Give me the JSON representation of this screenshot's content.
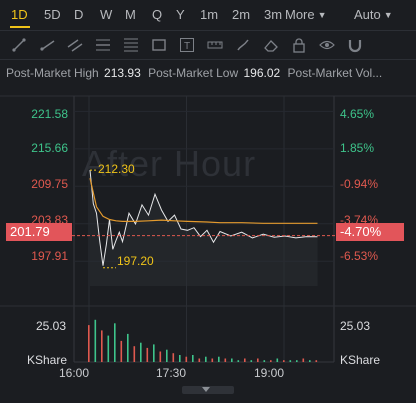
{
  "timeframes": {
    "items": [
      "1D",
      "5D",
      "D",
      "W",
      "M",
      "Q",
      "Y",
      "1m",
      "2m",
      "3m"
    ],
    "active": "1D",
    "more_label": "More",
    "auto_label": "Auto"
  },
  "toolbar_icons": [
    "trend-line-icon",
    "ray-tool-icon",
    "parallel-channel-icon",
    "horizontal-line-icon",
    "fibonacci-icon",
    "rectangle-icon",
    "text-tool-icon",
    "measure-icon",
    "brush-icon",
    "eraser-icon",
    "lock-icon",
    "visibility-icon",
    "magnet-icon"
  ],
  "info_bar": {
    "high_label": "Post-Market High",
    "high_value": "213.93",
    "low_label": "Post-Market Low",
    "low_value": "196.02",
    "vol_label": "Post-Market Vol..."
  },
  "watermark": "After Hour",
  "price_axis": [
    "221.58",
    "215.66",
    "209.75",
    "203.83",
    "197.91"
  ],
  "pct_axis": [
    "4.65%",
    "1.85%",
    "-0.94%",
    "-3.74%",
    "-6.53%"
  ],
  "current_price": "201.79",
  "current_pct": "-4.70%",
  "session_high": "212.30",
  "session_low": "197.20",
  "volume": {
    "top_label": "25.03",
    "unit_label": "KShare",
    "right_top_label": "25.03",
    "right_unit_label": "KShare"
  },
  "time_axis": [
    "16:00",
    "17:30",
    "19:00"
  ],
  "colors": {
    "up": "#3ec48b",
    "down": "#e0594f",
    "accent": "#f0c419",
    "avg_line": "#e39a2e",
    "price_line": "#e6e7e9"
  },
  "chart_data": {
    "type": "line",
    "title": "",
    "x_range": [
      "16:00",
      "20:00"
    ],
    "price_ylim": [
      194.0,
      224.0
    ],
    "reference_close": 211.7,
    "series": [
      {
        "x": [
          "16:00",
          "16:03",
          "16:06",
          "16:09",
          "16:12",
          "16:15",
          "16:18",
          "16:21",
          "16:24",
          "16:27",
          "16:30",
          "16:36",
          "16:42",
          "16:48",
          "16:54",
          "17:00",
          "17:06",
          "17:12",
          "17:18",
          "17:24",
          "17:30",
          "17:36",
          "17:42",
          "17:48",
          "17:54",
          "18:00",
          "18:10",
          "18:20",
          "18:30",
          "18:40",
          "18:50",
          "19:00",
          "19:10",
          "19:20",
          "19:30"
        ],
        "values": [
          212.3,
          207.0,
          205.5,
          201.0,
          197.2,
          200.5,
          204.5,
          199.8,
          201.2,
          202.5,
          201.0,
          205.5,
          203.8,
          206.8,
          205.2,
          208.5,
          206.0,
          204.2,
          205.2,
          203.0,
          202.8,
          203.2,
          201.8,
          202.8,
          200.9,
          202.6,
          201.9,
          202.5,
          201.6,
          202.2,
          201.7,
          201.9,
          201.6,
          201.8,
          201.79
        ]
      },
      {
        "x": [
          "16:00",
          "16:06",
          "16:12",
          "16:18",
          "16:24",
          "16:30",
          "16:42",
          "16:54",
          "17:06",
          "17:18",
          "17:30",
          "17:48",
          "18:00",
          "18:20",
          "18:40",
          "19:00",
          "19:20",
          "19:30"
        ],
        "values": [
          211.0,
          206.5,
          205.0,
          204.5,
          204.3,
          204.2,
          204.2,
          204.3,
          204.4,
          204.3,
          204.2,
          204.1,
          204.0,
          204.0,
          203.9,
          203.9,
          203.9,
          203.9
        ]
      }
    ],
    "volume": {
      "ylim": [
        0,
        25.03
      ],
      "x": [
        "16:00",
        "16:06",
        "16:12",
        "16:18",
        "16:24",
        "16:30",
        "16:36",
        "16:42",
        "16:48",
        "16:54",
        "17:00",
        "17:06",
        "17:12",
        "17:18",
        "17:24",
        "17:30",
        "17:36",
        "17:42",
        "17:48",
        "17:54",
        "18:00",
        "18:06",
        "18:12",
        "18:18",
        "18:24",
        "18:30",
        "18:36",
        "18:42",
        "18:48",
        "18:54",
        "19:00",
        "19:06",
        "19:12",
        "19:18",
        "19:24",
        "19:30"
      ],
      "values": [
        21,
        24,
        18,
        15,
        22,
        12,
        16,
        9,
        11,
        8,
        10,
        6,
        7,
        5,
        4,
        3,
        4,
        2,
        3,
        2,
        3,
        2,
        2,
        1,
        2,
        1,
        2,
        1,
        1,
        2,
        1,
        1,
        1,
        2,
        1,
        1
      ],
      "up": [
        false,
        true,
        false,
        true,
        true,
        false,
        true,
        false,
        true,
        false,
        true,
        false,
        true,
        false,
        true,
        false,
        true,
        false,
        true,
        false,
        true,
        false,
        true,
        true,
        false,
        true,
        false,
        true,
        false,
        true,
        false,
        true,
        true,
        false,
        true,
        false
      ]
    }
  }
}
